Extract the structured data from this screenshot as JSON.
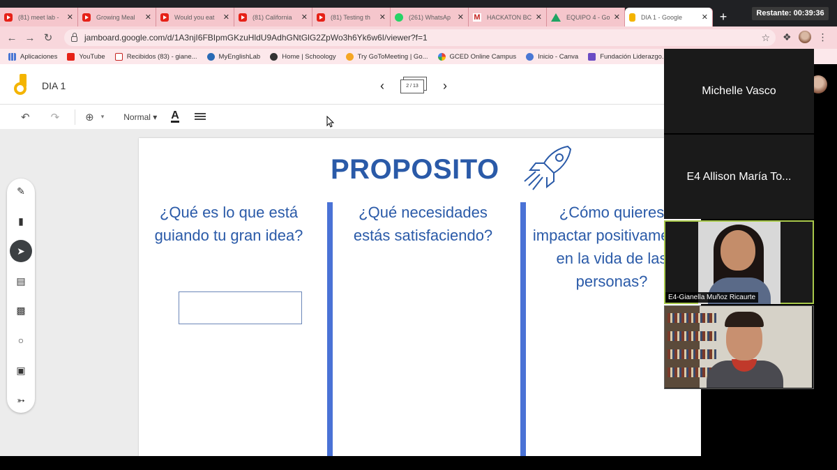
{
  "browser": {
    "tabs": [
      {
        "icon": "youtube",
        "title": "(81) meet lab -"
      },
      {
        "icon": "youtube",
        "title": "Growing Meal"
      },
      {
        "icon": "youtube",
        "title": "Would you eat"
      },
      {
        "icon": "youtube",
        "title": "(81) California"
      },
      {
        "icon": "youtube",
        "title": "(81) Testing th"
      },
      {
        "icon": "whatsapp",
        "title": "(261) WhatsAp"
      },
      {
        "icon": "gmail",
        "title": "HACKATON BC"
      },
      {
        "icon": "drive",
        "title": "EQUIPO 4 - Go"
      },
      {
        "icon": "jamboard",
        "title": "DIA 1 - Google"
      }
    ],
    "new_tab": "+",
    "url": "jamboard.google.com/d/1A3njI6FBIpmGKzuHldU9AdhGNtGlG2ZpWo3h6Yk6w6I/viewer?f=1",
    "bookmarks": [
      {
        "icon": "grid",
        "label": "Aplicaciones"
      },
      {
        "icon": "yt",
        "label": "YouTube"
      },
      {
        "icon": "gm",
        "label": "Recibidos (83) - giane..."
      },
      {
        "icon": "ml",
        "label": "MyEnglishLab"
      },
      {
        "icon": "sc",
        "label": "Home | Schoology"
      },
      {
        "icon": "gt",
        "label": "Try GoToMeeting | Go..."
      },
      {
        "icon": "gg",
        "label": "GCED Online Campus"
      },
      {
        "icon": "cv",
        "label": "Inicio - Canva"
      },
      {
        "icon": "fl",
        "label": "Fundación Liderazgo..."
      }
    ]
  },
  "timer": "Restante: 00:39:36",
  "jamboard": {
    "doc_title": "DIA 1",
    "frame_counter": "2 / 13",
    "font_style": "Normal",
    "text_color_label": "A"
  },
  "frame": {
    "title": "PROPOSITO",
    "questions": [
      "¿Qué es lo que está guiando tu gran idea?",
      "¿Qué necesidades estás satisfaciendo?",
      "¿Cómo quieres impactar positivamente en la vida de las personas?"
    ]
  },
  "participants": [
    {
      "name": "Michelle Vasco"
    },
    {
      "name": "E4 Allison María To..."
    },
    {
      "name": "E4-Gianella Muñoz Ricaurte"
    },
    {
      "name": ""
    }
  ],
  "colors": {
    "accent_blue": "#2a5aa8",
    "column_blue": "#4a72d6",
    "tab_pink": "#f5c6cc",
    "active_speaker": "#a8c84a"
  }
}
